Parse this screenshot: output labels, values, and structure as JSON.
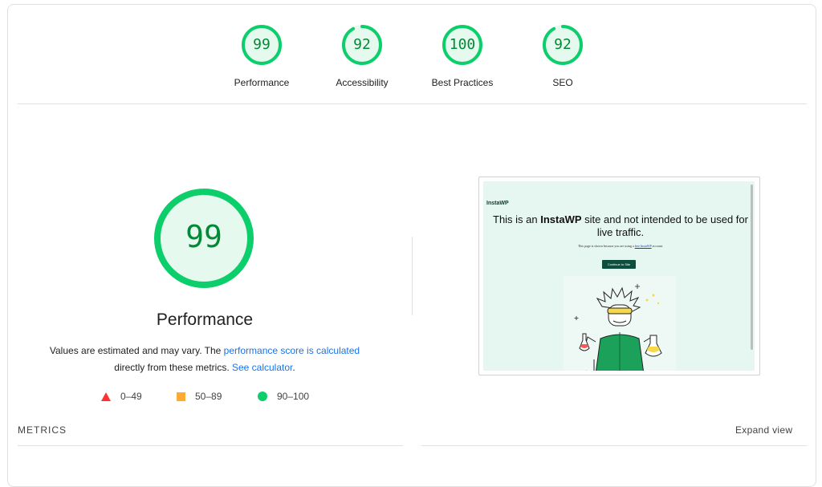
{
  "gauges": [
    {
      "score": "99",
      "label": "Performance",
      "fraction": 0.99
    },
    {
      "score": "92",
      "label": "Accessibility",
      "fraction": 0.92
    },
    {
      "score": "100",
      "label": "Best Practices",
      "fraction": 1.0
    },
    {
      "score": "92",
      "label": "SEO",
      "fraction": 0.92
    }
  ],
  "performance": {
    "score": "99",
    "fraction": 0.99,
    "title": "Performance",
    "desc_prefix": "Values are estimated and may vary. The ",
    "desc_link": "performance score is calculated",
    "desc_mid": " directly from these metrics. ",
    "desc_link2": "See calculator",
    "desc_suffix": "."
  },
  "legend": [
    {
      "shape": "triangle",
      "range": "0–49",
      "color": "#ff3333"
    },
    {
      "shape": "square",
      "range": "50–89",
      "color": "#ffaa33"
    },
    {
      "shape": "circle",
      "range": "90–100",
      "color": "#0cce6b"
    }
  ],
  "screenshot": {
    "logo": "InstaWP",
    "headline_pre": "This is an ",
    "headline_bold": "InstaWP",
    "headline_post": " site and not intended to be used for live traffic.",
    "note_pre": "This page is shown because you are using a ",
    "note_link": "free InstaWP",
    "note_post": " account.",
    "button": "Continue to Site"
  },
  "metrics": {
    "label": "METRICS",
    "expand": "Expand view"
  },
  "colors": {
    "pass": "#0cce6b",
    "pass_text": "#008a35",
    "pass_fill": "#e6f9ee",
    "link": "#1a73e8"
  }
}
